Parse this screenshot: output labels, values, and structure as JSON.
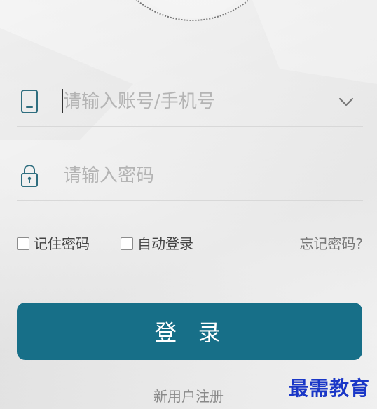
{
  "login": {
    "account": {
      "placeholder": "请输入账号/手机号",
      "value": ""
    },
    "password": {
      "placeholder": "请输入密码",
      "value": ""
    },
    "remember_password_label": "记住密码",
    "auto_login_label": "自动登录",
    "forgot_password_label": "忘记密码?",
    "login_button_label": "登 录",
    "register_label": "新用户注册"
  },
  "icons": {
    "account": "phone-icon",
    "password": "lock-icon",
    "dropdown": "chevron-down-icon"
  },
  "colors": {
    "accent": "#176f88",
    "watermark": "#1a37c7"
  },
  "watermark": "最需教育"
}
